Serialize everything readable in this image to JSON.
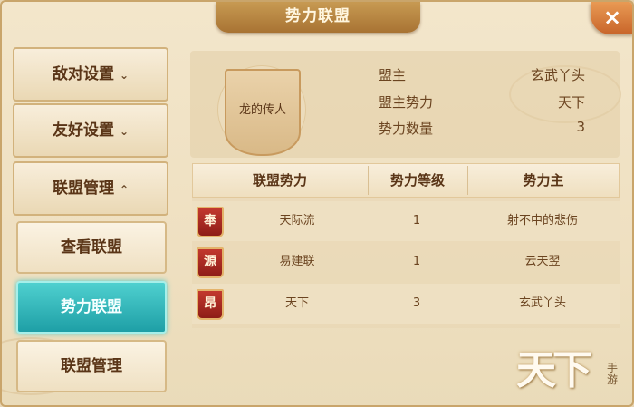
{
  "window": {
    "title": "势力联盟",
    "close_icon": "×"
  },
  "sidebar": {
    "items": [
      {
        "label": "敌对设置",
        "chevron": "⌄"
      },
      {
        "label": "友好设置",
        "chevron": "⌄"
      },
      {
        "label": "联盟管理",
        "chevron": "⌃"
      }
    ],
    "subitems": [
      {
        "label": "查看联盟"
      },
      {
        "label": "势力联盟"
      },
      {
        "label": "联盟管理"
      }
    ]
  },
  "alliance_info": {
    "emblem_name": "龙的传人",
    "leader_label": "盟主",
    "leader_value": "玄武丫头",
    "leader_power_label": "盟主势力",
    "leader_power_value": "天下",
    "power_count_label": "势力数量",
    "power_count_value": "3"
  },
  "table": {
    "headers": [
      "联盟势力",
      "势力等级",
      "势力主"
    ],
    "rows": [
      {
        "tag": "奉",
        "name": "天际流",
        "level": "1",
        "owner": "射不中的悲伤"
      },
      {
        "tag": "源",
        "name": "易建联",
        "level": "1",
        "owner": "云天翌"
      },
      {
        "tag": "昂",
        "name": "天下",
        "level": "3",
        "owner": "玄武丫头"
      }
    ]
  },
  "logo": {
    "main": "天下",
    "sub": "手游"
  },
  "colors": {
    "accent_active": "#1e9fa6",
    "title_bar": "#a87333",
    "tag_red": "#8e1d17"
  }
}
